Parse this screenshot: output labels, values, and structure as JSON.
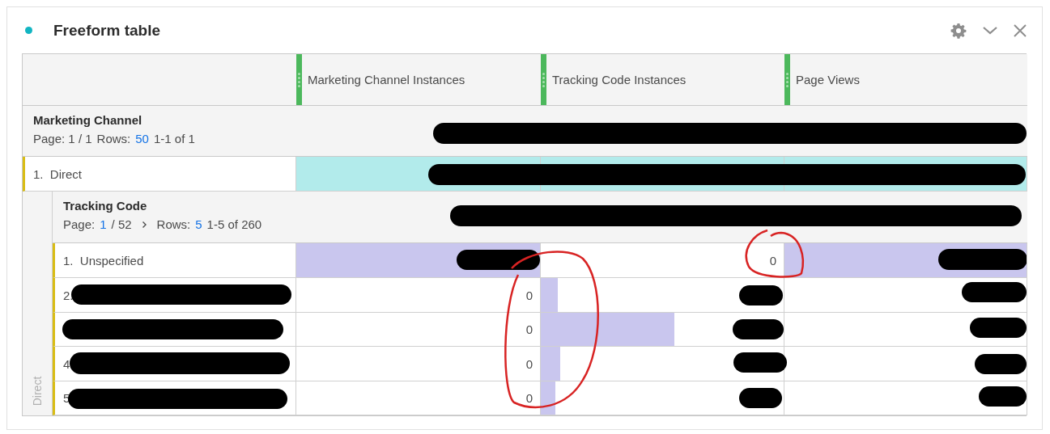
{
  "panel": {
    "title": "Freeform table"
  },
  "columns": [
    "Marketing Channel Instances",
    "Tracking Code Instances",
    "Page Views"
  ],
  "dimension": {
    "name": "Marketing Channel",
    "page": "Page: 1 / 1",
    "rows_label": "Rows:",
    "rows_per_page": "50",
    "range": "1-1 of 1"
  },
  "rows": [
    {
      "label": "1.  Direct",
      "cells": [
        {
          "level": 1
        },
        {
          "level": 1
        },
        {
          "level": 1
        }
      ],
      "breakdown": {
        "gutter_label": "Direct",
        "name": "Tracking Code",
        "page_label": "Page:",
        "page": "1",
        "page_total": "/ 52",
        "rows_label": "Rows:",
        "rows_per_page": "5",
        "range": "1-5 of 260",
        "rows": [
          {
            "label": "1.  Unspecified",
            "cells": [
              {
                "level": 1
              },
              {
                "value": "0"
              },
              {
                "level": 1
              }
            ]
          },
          {
            "label": "2.",
            "cells": [
              {
                "value": "0"
              },
              {
                "level": 0.07
              },
              {}
            ]
          },
          {
            "cells": [
              {
                "value": "0"
              },
              {
                "level": 0.55
              },
              {}
            ]
          },
          {
            "label": "4",
            "cells": [
              {
                "value": "0"
              },
              {
                "level": 0.08
              },
              {}
            ]
          },
          {
            "label": "5",
            "cells": [
              {
                "value": "0"
              },
              {
                "level": 0.06
              },
              {}
            ]
          }
        ]
      }
    }
  ]
}
